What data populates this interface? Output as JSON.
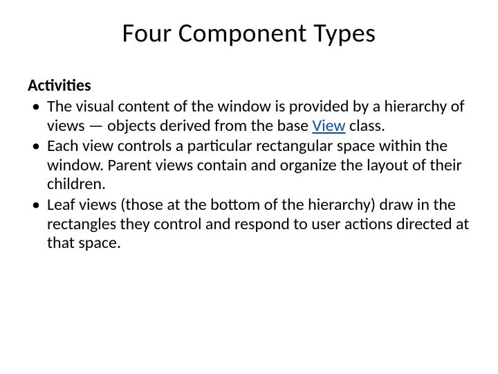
{
  "title": "Four Component Types",
  "subheading": "Activities",
  "bullets": {
    "b1_pre": "The visual content of the window is provided by a hierarchy of views — objects derived from the base ",
    "b1_link": "View",
    "b1_post": " class.",
    "b2": "Each view controls a particular rectangular space within the window. Parent views contain and organize the layout of their children.",
    "b3": "Leaf views (those at the bottom of the hierarchy) draw in the rectangles they control and respond to user actions directed at that space."
  }
}
